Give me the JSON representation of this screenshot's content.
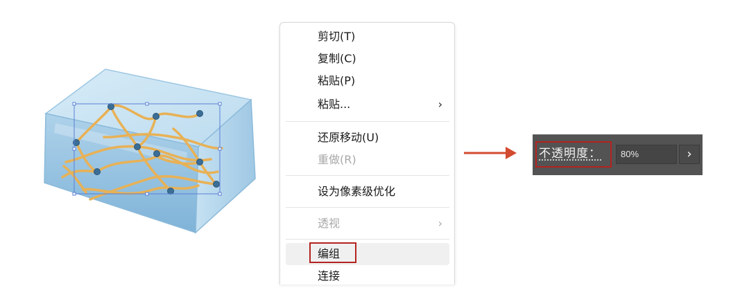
{
  "menu": {
    "items": [
      {
        "label": "剪切(T)",
        "enabled": true,
        "submenu": false
      },
      {
        "label": "复制(C)",
        "enabled": true,
        "submenu": false
      },
      {
        "label": "粘贴(P)",
        "enabled": true,
        "submenu": false
      },
      {
        "label": "粘贴...",
        "enabled": true,
        "submenu": true
      },
      {
        "label": "还原移动(U)",
        "enabled": true,
        "submenu": false
      },
      {
        "label": "重做(R)",
        "enabled": false,
        "submenu": false
      },
      {
        "label": "设为像素级优化",
        "enabled": true,
        "submenu": false
      },
      {
        "label": "透视",
        "enabled": false,
        "submenu": true
      },
      {
        "label": "编组",
        "enabled": true,
        "submenu": false,
        "highlighted": true
      },
      {
        "label": "连接",
        "enabled": true,
        "submenu": false
      }
    ],
    "submenu_chevron": "›"
  },
  "opacity_panel": {
    "label": "不透明度：",
    "value": "80%",
    "expand_chevron": "›"
  },
  "colors": {
    "highlight_border": "#b3231f",
    "arrow": "#d24a2f",
    "panel_bg": "#535353",
    "box_fill": "#b7d8ec",
    "fiber": "#e8b155",
    "node": "#3b6e96",
    "selection": "#5a7fd6"
  },
  "icons": {
    "arrow": "right-arrow-icon",
    "chevron": "chevron-right-icon"
  }
}
